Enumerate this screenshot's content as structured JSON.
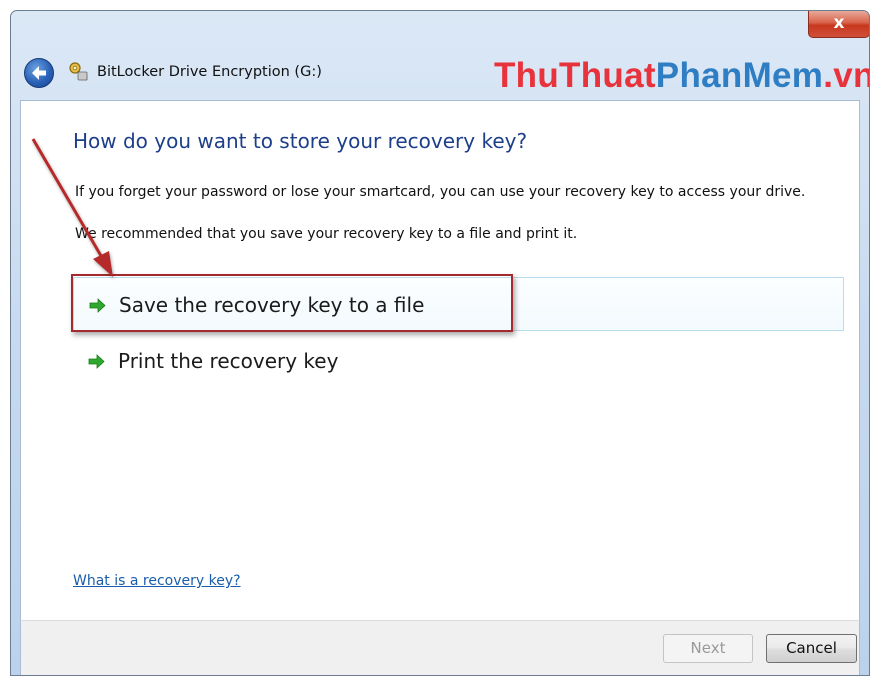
{
  "window": {
    "title": "BitLocker Drive Encryption (G:)",
    "close_glyph": "x"
  },
  "watermark": {
    "part1": "ThuThuat",
    "part2": "PhanMem",
    "part3": ".vn",
    "color1": "#e8323c",
    "color2": "#2f7ec4",
    "color3": "#e8323c"
  },
  "content": {
    "heading": "How do you want to store your recovery key?",
    "paragraph1": "If you forget your password or lose your smartcard, you can use your recovery key to access your drive.",
    "paragraph2": "We recommended that you save your recovery key to a file and print it.",
    "options": [
      {
        "label": "Save the recovery key to a file",
        "icon": "green-arrow-icon"
      },
      {
        "label": "Print the recovery key",
        "icon": "green-arrow-icon"
      }
    ],
    "help_link": "What is a recovery key?"
  },
  "footer": {
    "next_label": "Next",
    "cancel_label": "Cancel"
  },
  "colors": {
    "heading": "#1d3f8a",
    "link": "#1a5dab",
    "annotation": "#a52a2f",
    "option_arrow": "#2ea82e"
  }
}
